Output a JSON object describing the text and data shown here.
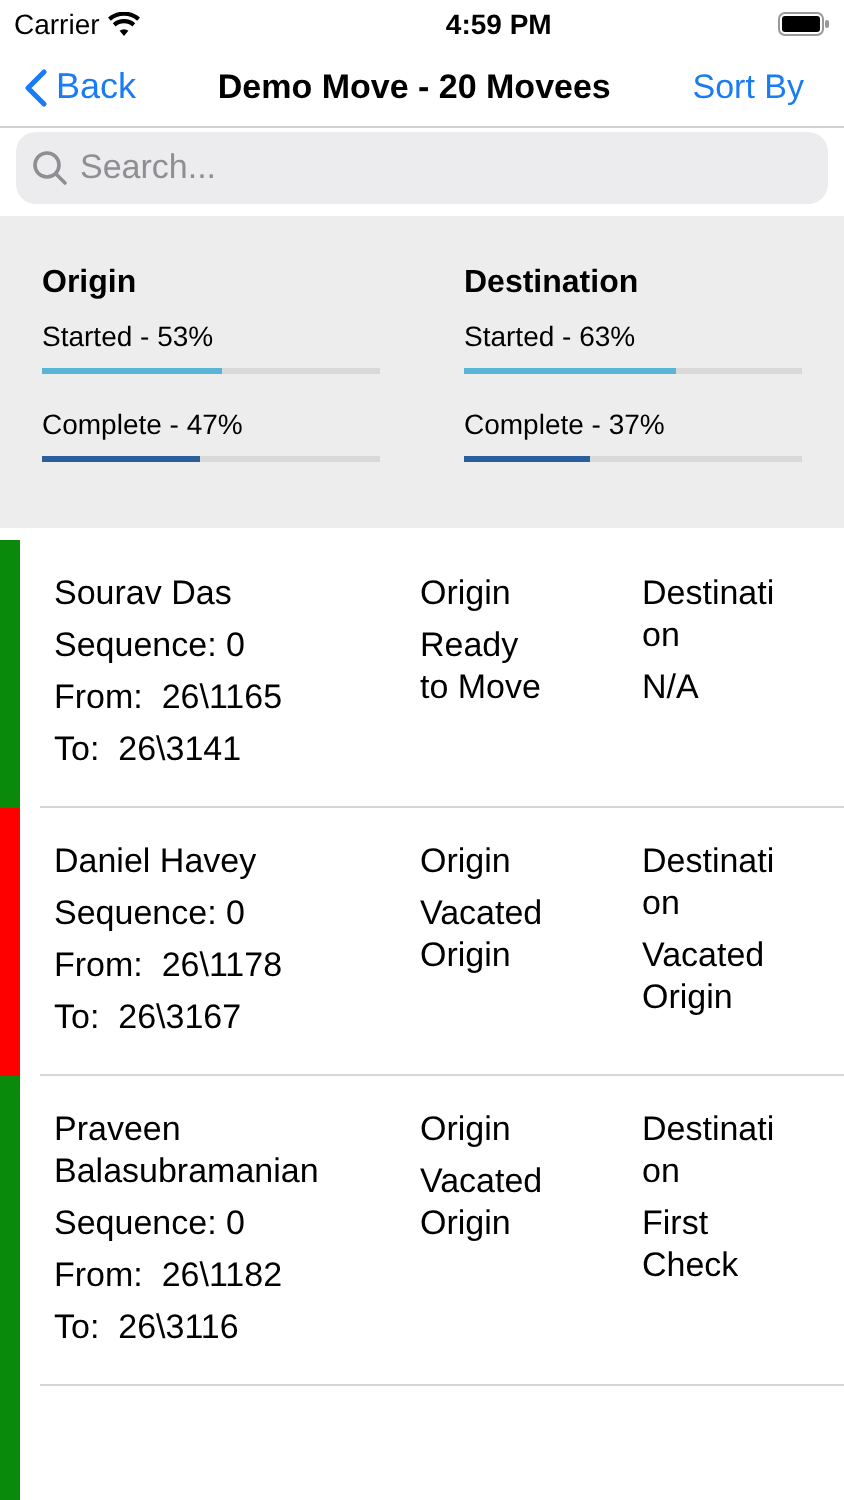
{
  "status_bar": {
    "carrier": "Carrier",
    "time": "4:59 PM"
  },
  "nav": {
    "back": "Back",
    "title": "Demo Move - 20 Movees",
    "action": "Sort By"
  },
  "search": {
    "placeholder": "Search..."
  },
  "summary": [
    {
      "title": "Origin",
      "bars": [
        {
          "kind": "started",
          "label": "Started - 53%",
          "level": 0.53
        },
        {
          "kind": "complete",
          "label": "Complete - 47%",
          "level": 0.47
        }
      ]
    },
    {
      "title": "Destination",
      "bars": [
        {
          "kind": "started",
          "label": "Started - 63%",
          "level": 0.63
        },
        {
          "kind": "complete",
          "label": "Complete - 37%",
          "level": 0.37
        }
      ]
    }
  ],
  "movees": [
    {
      "color": "#0a8a0a",
      "name": "Sourav Das",
      "sequence": "Sequence: 0",
      "from": "From:  26\\1165",
      "to": "To:  26\\3141",
      "origin_label": "Origin",
      "origin_status": "Ready to Move",
      "destination_label": "Destination",
      "destination_status": "N/A"
    },
    {
      "color": "#ff0000",
      "name": "Daniel Havey",
      "sequence": "Sequence: 0",
      "from": "From:  26\\1178",
      "to": "To:  26\\3167",
      "origin_label": "Origin",
      "origin_status": "Vacated Origin",
      "destination_label": "Destination",
      "destination_status": "Vacated Origin"
    },
    {
      "color": "#0a8a0a",
      "name": "Praveen Balasubramanian",
      "sequence": "Sequence: 0",
      "from": "From:  26\\1182",
      "to": "To:  26\\3116",
      "origin_label": "Origin",
      "origin_status": "Vacated Origin",
      "destination_label": "Destination",
      "destination_status": "First Check"
    }
  ],
  "partial_row": {
    "color": "#0a8a0a"
  }
}
